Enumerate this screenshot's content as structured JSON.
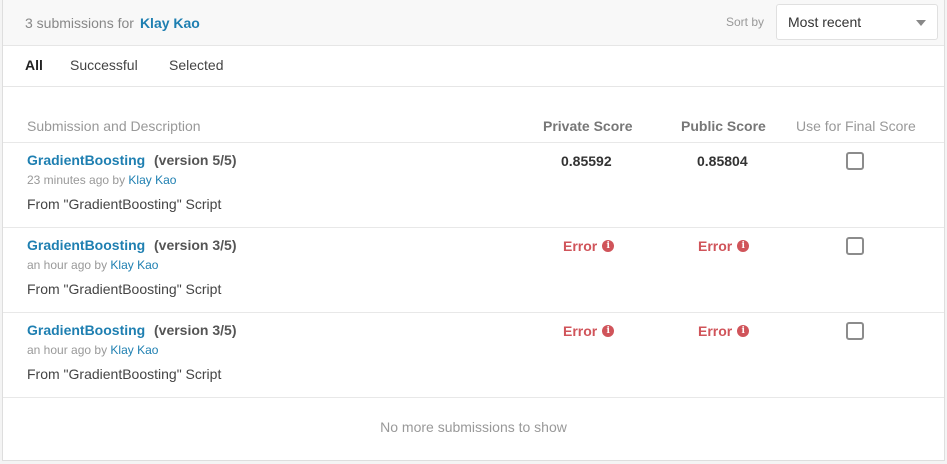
{
  "header": {
    "count_text": "3 submissions for",
    "user": "Klay Kao",
    "sort_label": "Sort by",
    "sort_value": "Most recent"
  },
  "tabs": [
    {
      "label": "All",
      "active": true
    },
    {
      "label": "Successful",
      "active": false
    },
    {
      "label": "Selected",
      "active": false
    }
  ],
  "columns": {
    "description": "Submission and Description",
    "private": "Private Score",
    "public": "Public Score",
    "use_final": "Use for Final Score"
  },
  "submissions": [
    {
      "name": "GradientBoosting",
      "version": "(version 5/5)",
      "time": "23 minutes ago by",
      "author": "Klay Kao",
      "description": "From \"GradientBoosting\" Script",
      "private_score": "0.85592",
      "public_score": "0.85804",
      "selected": false
    },
    {
      "name": "GradientBoosting",
      "version": "(version 3/5)",
      "time": "an hour ago by",
      "author": "Klay Kao",
      "description": "From \"GradientBoosting\" Script",
      "private_score": "Error",
      "public_score": "Error",
      "selected": false
    },
    {
      "name": "GradientBoosting",
      "version": "(version 3/5)",
      "time": "an hour ago by",
      "author": "Klay Kao",
      "description": "From \"GradientBoosting\" Script",
      "private_score": "Error",
      "public_score": "Error",
      "selected": false
    }
  ],
  "footer": "No more submissions to show",
  "colors": {
    "link": "#1e7fb1",
    "error": "#d0545a"
  }
}
